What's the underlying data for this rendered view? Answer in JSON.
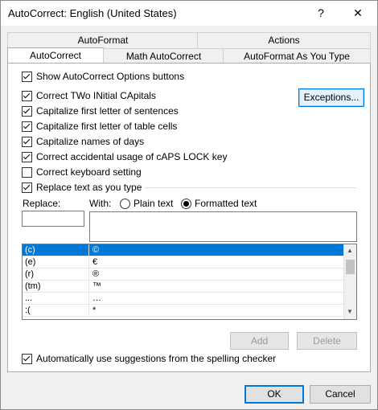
{
  "window": {
    "title": "AutoCorrect: English (United States)",
    "help": "?",
    "close": "✕"
  },
  "tabs": {
    "row1": [
      "AutoFormat",
      "Actions"
    ],
    "row2": [
      "AutoCorrect",
      "Math AutoCorrect",
      "AutoFormat As You Type"
    ]
  },
  "options": {
    "show_buttons": "Show AutoCorrect Options buttons",
    "two_initial": "Correct TWo INitial CApitals",
    "first_sentence": "Capitalize first letter of sentences",
    "first_table": "Capitalize first letter of table cells",
    "names_days": "Capitalize names of days",
    "caps_lock": "Correct accidental usage of cAPS LOCK key",
    "keyboard": "Correct keyboard setting",
    "replace_typing": "Replace text as you type",
    "spelling": "Automatically use suggestions from the spelling checker"
  },
  "buttons": {
    "exceptions": "Exceptions...",
    "add": "Add",
    "delete": "Delete",
    "ok": "OK",
    "cancel": "Cancel"
  },
  "replace": {
    "replace_label": "Replace:",
    "with_label": "With:",
    "plain": "Plain text",
    "formatted": "Formatted text",
    "replace_value": "",
    "with_value": ""
  },
  "entries": [
    {
      "from": "(c)",
      "to": "©"
    },
    {
      "from": "(e)",
      "to": "€"
    },
    {
      "from": "(r)",
      "to": "®"
    },
    {
      "from": "(tm)",
      "to": "™"
    },
    {
      "from": "...",
      "to": "…"
    },
    {
      "from": ":(",
      "to": "*"
    }
  ],
  "colors": {
    "selection": "#0078d7",
    "accent": "#0078d7"
  }
}
